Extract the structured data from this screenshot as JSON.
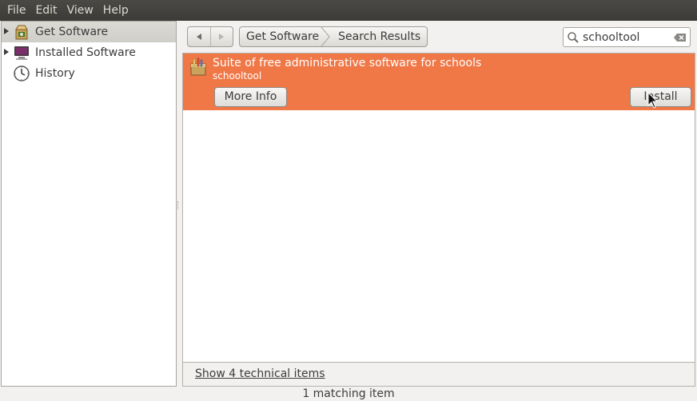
{
  "menubar": {
    "items": [
      "File",
      "Edit",
      "View",
      "Help"
    ]
  },
  "sidebar": {
    "items": [
      {
        "label": "Get Software",
        "icon": "software-center-icon",
        "selected": true
      },
      {
        "label": "Installed Software",
        "icon": "computer-icon",
        "selected": false
      },
      {
        "label": "History",
        "icon": "clock-icon",
        "selected": false
      }
    ]
  },
  "toolbar": {
    "breadcrumbs": [
      "Get Software",
      "Search Results"
    ],
    "search": {
      "value": "schooltool"
    }
  },
  "results": {
    "items": [
      {
        "summary": "Suite of free administrative software for schools",
        "package": "schooltool",
        "icon": "package-icon",
        "more_info_label": "More Info",
        "install_label": "Install"
      }
    ]
  },
  "footer": {
    "technical_link": "Show 4 technical items"
  },
  "status": {
    "text": "1 matching item"
  },
  "colors": {
    "menubar": "#3c3b37",
    "selection": "#f07746",
    "window_bg": "#f2f1f0"
  }
}
